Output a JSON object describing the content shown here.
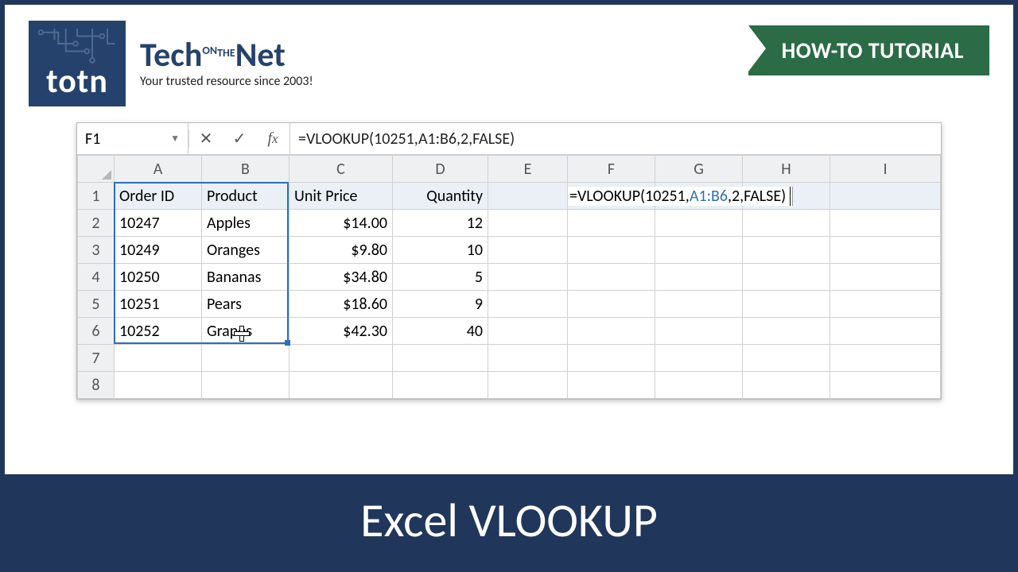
{
  "brand": {
    "box": "totn",
    "name_tech": "Tech",
    "name_on": "ON",
    "name_the": "THE",
    "name_net": "Net",
    "tagline": "Your trusted resource since 2003!"
  },
  "banner": {
    "label": "HOW-TO TUTORIAL"
  },
  "namebox": {
    "value": "F1"
  },
  "formula_bar": {
    "value": "=VLOOKUP(10251,A1:B6,2,FALSE)"
  },
  "columns": [
    "A",
    "B",
    "C",
    "D",
    "E",
    "F",
    "G",
    "H",
    "I"
  ],
  "rows": [
    "1",
    "2",
    "3",
    "4",
    "5",
    "6",
    "7",
    "8"
  ],
  "headers": {
    "A": "Order ID",
    "B": "Product",
    "C": "Unit Price",
    "D": "Quantity"
  },
  "data": [
    {
      "A": "10247",
      "B": "Apples",
      "C": "$14.00",
      "D": "12"
    },
    {
      "A": "10249",
      "B": "Oranges",
      "C": "$9.80",
      "D": "10"
    },
    {
      "A": "10250",
      "B": "Bananas",
      "C": "$34.80",
      "D": "5"
    },
    {
      "A": "10251",
      "B": "Pears",
      "C": "$18.60",
      "D": "9"
    },
    {
      "A": "10252",
      "B": "Grapes",
      "C": "$42.30",
      "D": "40"
    }
  ],
  "f1_formula": {
    "pre": "=VLOOKUP(10251,",
    "range": "A1:B6",
    "post": ",2,FALSE)"
  },
  "footer": {
    "title": "Excel VLOOKUP"
  }
}
